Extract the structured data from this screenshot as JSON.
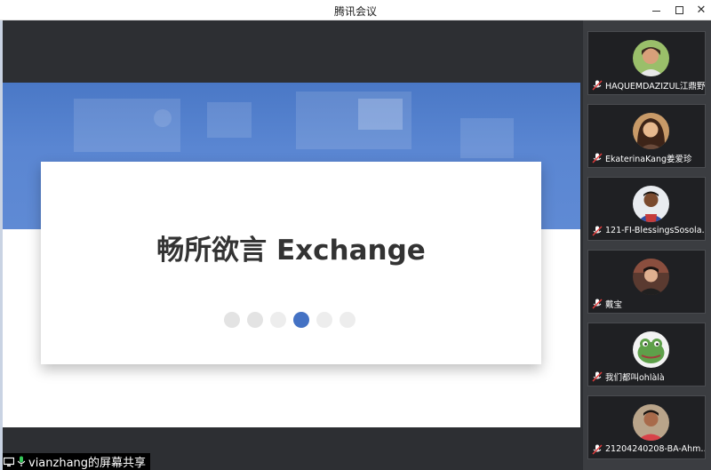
{
  "window": {
    "title": "腾讯会议",
    "minimize_icon": "minimize-icon",
    "maximize_icon": "maximize-icon",
    "close_icon": "close-icon"
  },
  "slide": {
    "title": "畅所欲言 Exchange",
    "pagination": {
      "total": 6,
      "active_index": 3
    }
  },
  "share_label": "vianzhang的屏幕共享",
  "participants": [
    {
      "name": "HAQUEMDAZIZUL江鼎野",
      "mic_icon": "mic-muted-icon"
    },
    {
      "name": "EkaterinaKang姜爱珍",
      "mic_icon": "mic-muted-icon"
    },
    {
      "name": "121-FI-BlessingsSosola…",
      "mic_icon": "mic-muted-icon"
    },
    {
      "name": "戴宝",
      "mic_icon": "mic-muted-icon"
    },
    {
      "name": "我们都叫ohlàlà",
      "mic_icon": "mic-muted-icon"
    },
    {
      "name": "21204240208-BA-Ahm…",
      "mic_icon": "mic-muted-icon"
    }
  ],
  "colors": {
    "accent": "#4472c4",
    "banner": "#5a86d2",
    "panel": "#3b3d41",
    "stage": "#2d2f33"
  }
}
